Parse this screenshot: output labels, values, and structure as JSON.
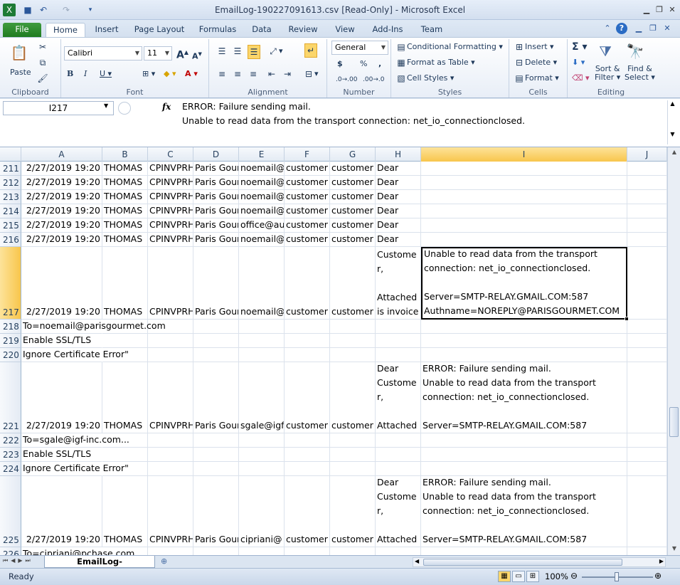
{
  "window": {
    "title": "EmailLog-190227091613.csv  [Read-Only]  -  Microsoft Excel"
  },
  "tabs": [
    "File",
    "Home",
    "Insert",
    "Page Layout",
    "Formulas",
    "Data",
    "Review",
    "View",
    "Add-Ins",
    "Team"
  ],
  "ribbon": {
    "clipboard": {
      "label": "Clipboard",
      "paste": "Paste"
    },
    "font": {
      "label": "Font",
      "name": "Calibri",
      "size": "11"
    },
    "alignment": {
      "label": "Alignment"
    },
    "number": {
      "label": "Number",
      "format": "General",
      "currency": "$",
      "percent": "%",
      "comma": ","
    },
    "styles": {
      "label": "Styles",
      "conditional": "Conditional Formatting",
      "table": "Format as Table",
      "cell": "Cell Styles"
    },
    "cells": {
      "label": "Cells",
      "insert": "Insert",
      "delete": "Delete",
      "format": "Format"
    },
    "editing": {
      "label": "Editing",
      "sum": "Σ",
      "sort_1": "Sort &",
      "sort_2": "Filter",
      "find_1": "Find &",
      "find_2": "Select"
    }
  },
  "formula_bar": {
    "name_box": "I217",
    "fx": "fx",
    "line1": "ERROR: Failure sending mail.",
    "line2": "Unable to read data from the transport connection: net_io_connectionclosed."
  },
  "columns": [
    "A",
    "B",
    "C",
    "D",
    "E",
    "F",
    "G",
    "H",
    "I",
    "J"
  ],
  "rows": [
    {
      "n": "211",
      "A": "2/27/2019 19:20",
      "B": "THOMAS",
      "C": "CPINVPRH",
      "D": "Paris Gour",
      "E": "noemail@",
      "F": "customer",
      "G": "customer",
      "H": "Dear",
      "I": ""
    },
    {
      "n": "212",
      "A": "2/27/2019 19:20",
      "B": "THOMAS",
      "C": "CPINVPRH",
      "D": "Paris Gour",
      "E": "noemail@",
      "F": "customer",
      "G": "customer",
      "H": "Dear",
      "I": ""
    },
    {
      "n": "213",
      "A": "2/27/2019 19:20",
      "B": "THOMAS",
      "C": "CPINVPRH",
      "D": "Paris Gour",
      "E": "noemail@",
      "F": "customer",
      "G": "customer",
      "H": "Dear",
      "I": ""
    },
    {
      "n": "214",
      "A": "2/27/2019 19:20",
      "B": "THOMAS",
      "C": "CPINVPRH",
      "D": "Paris Gour",
      "E": "noemail@",
      "F": "customer",
      "G": "customer",
      "H": "Dear",
      "I": ""
    },
    {
      "n": "215",
      "A": "2/27/2019 19:20",
      "B": "THOMAS",
      "C": "CPINVPRH",
      "D": "Paris Gour",
      "E": "office@au",
      "F": "customer",
      "G": "customer",
      "H": "Dear",
      "I": ""
    },
    {
      "n": "216",
      "A": "2/27/2019 19:20",
      "B": "THOMAS",
      "C": "CPINVPRH",
      "D": "Paris Gour",
      "E": "noemail@",
      "F": "customer",
      "G": "customer",
      "H": "Dear",
      "I": ""
    },
    {
      "n": "217",
      "A": "2/27/2019 19:20",
      "B": "THOMAS",
      "C": "CPINVPRH",
      "D": "Paris Gour",
      "E": "noemail@",
      "F": "customer",
      "G": "customer",
      "H": "Custome\nr,\n\nAttached\nis invoice",
      "I": "Unable to read data from the transport\nconnection: net_io_connectionclosed.\n\nServer=SMTP-RELAY.GMAIL.COM:587\nAuthname=NOREPLY@PARISGOURMET.COM"
    },
    {
      "n": "218",
      "overflow": "To=noemail@parisgourmet.com"
    },
    {
      "n": "219",
      "overflow": "Enable SSL/TLS"
    },
    {
      "n": "220",
      "overflow": "Ignore Certificate Error\""
    },
    {
      "n": "221",
      "A": "2/27/2019 19:20",
      "B": "THOMAS",
      "C": "CPINVPRH",
      "D": "Paris Gour",
      "E": "sgale@igf",
      "F": "customer",
      "G": "customer",
      "H": "Dear\nCustome\nr,\n\nAttached",
      "I": "ERROR: Failure sending mail.\nUnable to read data from the transport\nconnection: net_io_connectionclosed.\n\nServer=SMTP-RELAY.GMAIL.COM:587"
    },
    {
      "n": "222",
      "overflow": "To=sgale@igf-inc.com..."
    },
    {
      "n": "223",
      "overflow": "Enable SSL/TLS"
    },
    {
      "n": "224",
      "overflow": "Ignore Certificate Error\""
    },
    {
      "n": "225",
      "A": "2/27/2019 19:20",
      "B": "THOMAS",
      "C": "CPINVPRH",
      "D": "Paris Gour",
      "E": "cipriani@",
      "F": "customer",
      "G": "customer",
      "H": "Dear\nCustome\nr,\n\nAttached",
      "I": "ERROR: Failure sending mail.\nUnable to read data from the transport\nconnection: net_io_connectionclosed.\n\nServer=SMTP-RELAY.GMAIL.COM:587"
    },
    {
      "n": "226",
      "overflow": "To=cipriani@pchase.com"
    }
  ],
  "sheet_tab": "EmailLog-190227091613",
  "status": {
    "ready": "Ready",
    "zoom": "100%"
  }
}
